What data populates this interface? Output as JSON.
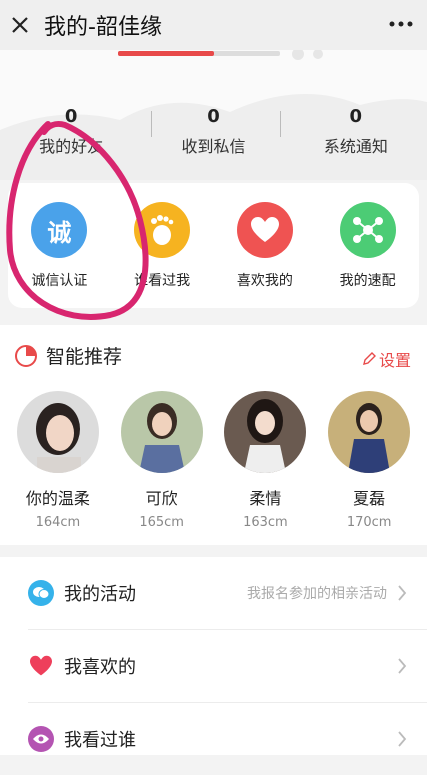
{
  "header": {
    "title": "我的-韶佳缘",
    "close_icon": "close-icon",
    "more_icon": "more-icon"
  },
  "profile": {
    "progress": 0.59
  },
  "stats": [
    {
      "value": "0",
      "label": "我的好友"
    },
    {
      "value": "0",
      "label": "收到私信"
    },
    {
      "value": "0",
      "label": "系统通知"
    }
  ],
  "quick_actions": [
    {
      "label": "诚信认证",
      "icon_text": "诚",
      "icon": "verify-icon",
      "color": "#4aa2ea"
    },
    {
      "label": "谁看过我",
      "icon": "footprint-icon",
      "color": "#f6b320"
    },
    {
      "label": "喜欢我的",
      "icon": "heart-icon",
      "color": "#ef5352"
    },
    {
      "label": "我的速配",
      "icon": "match-icon",
      "color": "#4ccc75"
    }
  ],
  "recommend": {
    "title": "智能推荐",
    "settings_label": "设置",
    "people": [
      {
        "name": "你的温柔",
        "height": "164cm"
      },
      {
        "name": "可欣",
        "height": "165cm"
      },
      {
        "name": "柔情",
        "height": "163cm"
      },
      {
        "name": "夏磊",
        "height": "170cm"
      }
    ]
  },
  "menu": [
    {
      "label": "我的活动",
      "hint": "我报名参加的相亲活动",
      "icon": "chat-bubbles-icon",
      "color": "#35b2ea"
    },
    {
      "label": "我喜欢的",
      "hint": "",
      "icon": "heart-icon",
      "color": "#ee3f5b"
    },
    {
      "label": "我看过谁",
      "hint": "",
      "icon": "eye-icon",
      "color": "#b454b2"
    }
  ]
}
